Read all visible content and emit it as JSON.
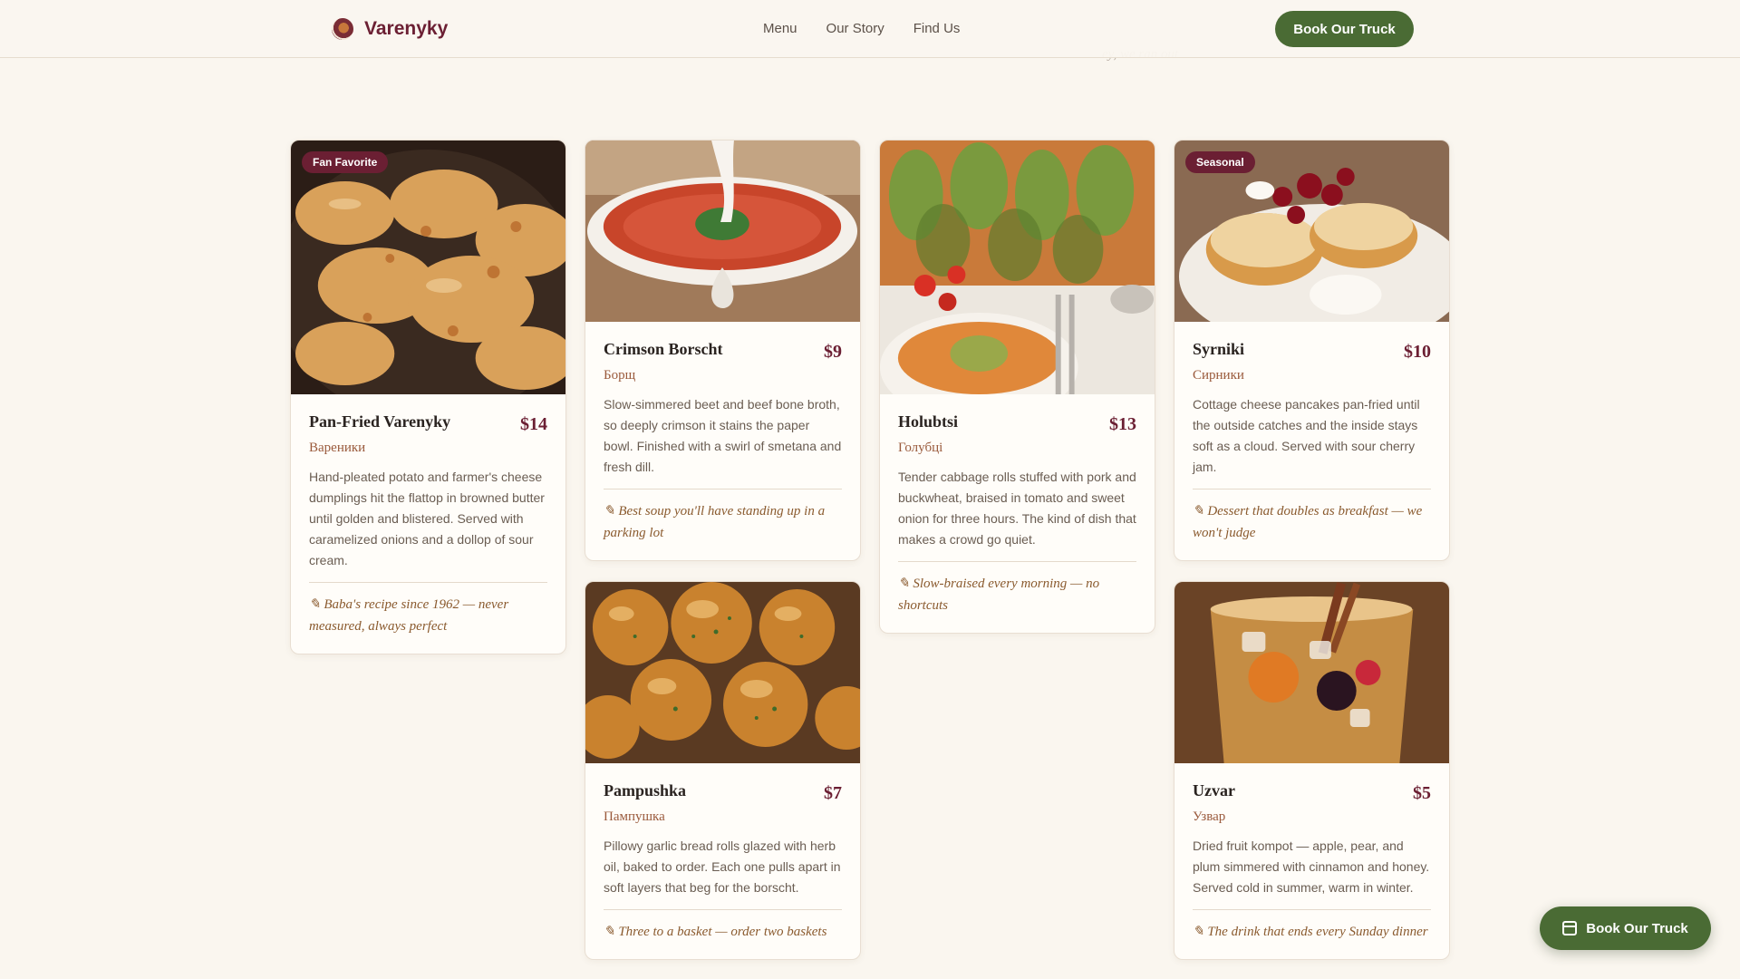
{
  "brand": {
    "name": "Varenyky",
    "logo_icon": "dumpling-logo-icon"
  },
  "nav": {
    "links": [
      "Menu",
      "Our Story",
      "Find Us"
    ],
    "cta": "Book Our Truck"
  },
  "ghost_text": "ey, we ran out",
  "cards": [
    {
      "name": "Pan-Fried Varenyky",
      "native": "Вареники",
      "price": "$14",
      "badge": "Fan Favorite",
      "description": "Hand-pleated potato and farmer's cheese dumplings hit the flattop in browned butter until golden and blistered. Served with caramelized onions and a dollop of sour cream.",
      "note": "✎ Baba's recipe since 1962 — never measured, always perfect"
    },
    {
      "name": "Crimson Borscht",
      "native": "Борщ",
      "price": "$9",
      "badge": "",
      "description": "Slow-simmered beet and beef bone broth, so deeply crimson it stains the paper bowl. Finished with a swirl of smetana and fresh dill.",
      "note": "✎ Best soup you'll have standing up in a parking lot"
    },
    {
      "name": "Holubtsi",
      "native": "Голубці",
      "price": "$13",
      "badge": "",
      "description": "Tender cabbage rolls stuffed with pork and buckwheat, braised in tomato and sweet onion for three hours. The kind of dish that makes a crowd go quiet.",
      "note": "✎ Slow-braised every morning — no shortcuts"
    },
    {
      "name": "Syrniki",
      "native": "Сирники",
      "price": "$10",
      "badge": "Seasonal",
      "description": "Cottage cheese pancakes pan-fried until the outside catches and the inside stays soft as a cloud. Served with sour cherry jam.",
      "note": "✎ Dessert that doubles as breakfast — we won't judge"
    },
    {
      "name": "Pampushka",
      "native": "Пампушка",
      "price": "$7",
      "badge": "",
      "description": "Pillowy garlic bread rolls glazed with herb oil, baked to order. Each one pulls apart in soft layers that beg for the borscht.",
      "note": "✎ Three to a basket — order two baskets"
    },
    {
      "name": "Uzvar",
      "native": "Узвар",
      "price": "$5",
      "badge": "",
      "description": "Dried fruit kompot — apple, pear, and plum simmered with cinnamon and honey. Served cold in summer, warm in winter.",
      "note": "✎ The drink that ends every Sunday dinner"
    }
  ],
  "floating_cta": {
    "label": "Book Our Truck",
    "icon": "calendar-icon"
  },
  "colors": {
    "accent": "#6b1f33",
    "cta": "#4a6b34",
    "background": "#faf6ef"
  }
}
